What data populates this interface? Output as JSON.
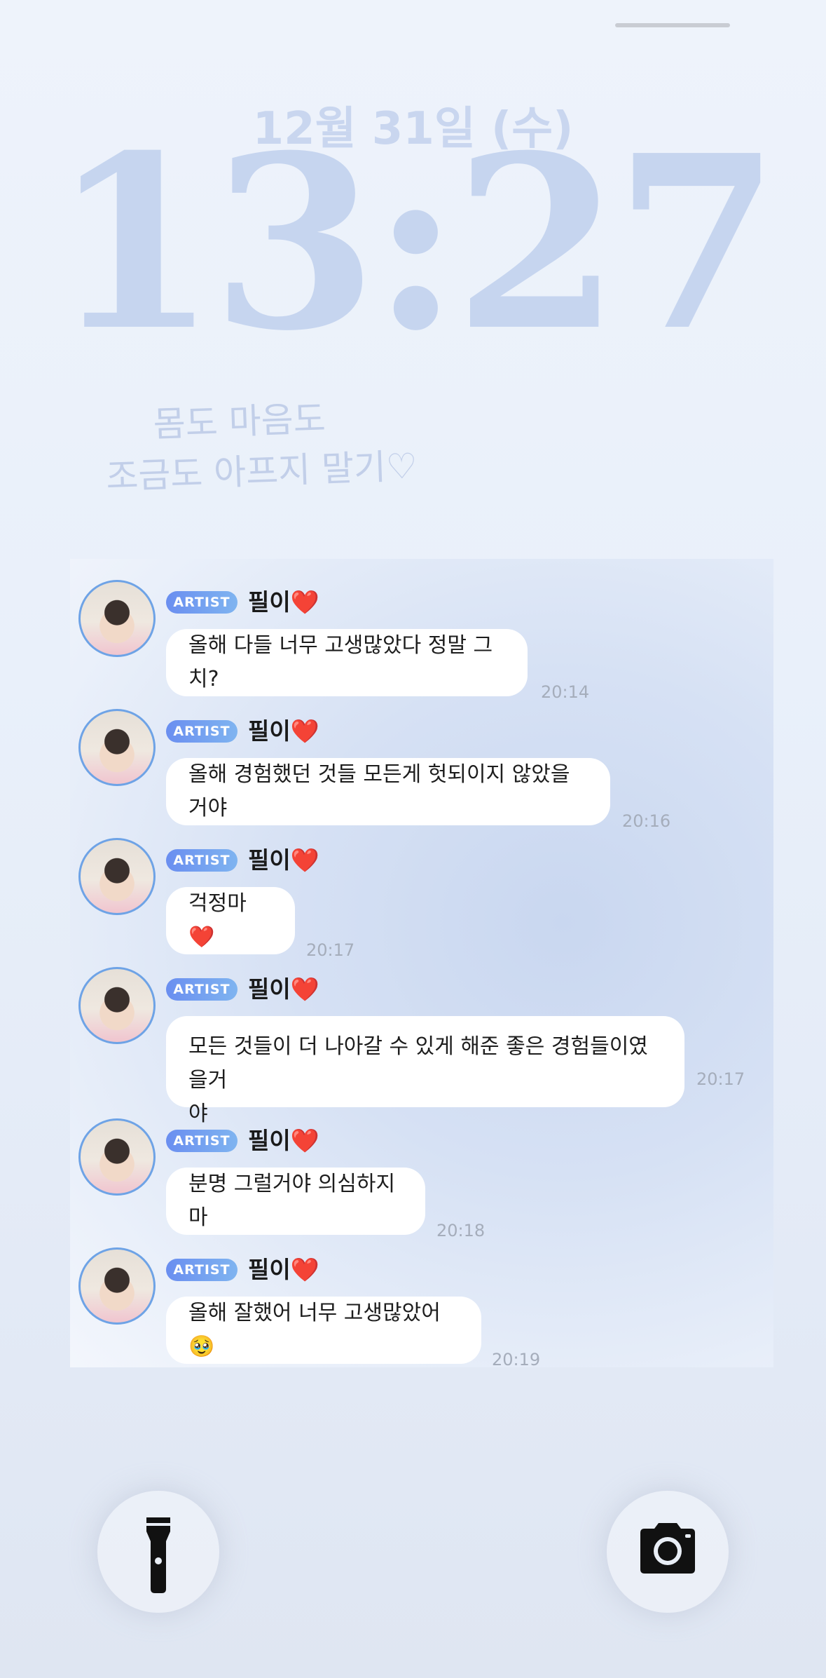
{
  "lockscreen": {
    "date": "12월 31일 (수)",
    "time": "13:27",
    "widget_line1": "몸도 마음도",
    "widget_line2": "조금도 아프지 말기♡"
  },
  "chat": {
    "messages": [
      {
        "badge": "ARTIST",
        "sender": "필이❤️",
        "text": "올해 다들 너무 고생많았다 정말 그치?",
        "time": "20:14"
      },
      {
        "badge": "ARTIST",
        "sender": "필이❤️",
        "text": "올해 경험했던 것들 모든게 헛되이지 않았을거야",
        "time": "20:16"
      },
      {
        "badge": "ARTIST",
        "sender": "필이❤️",
        "text": "걱정마❤️",
        "time": "20:17"
      },
      {
        "badge": "ARTIST",
        "sender": "필이❤️",
        "text_line1": "모든 것들이 더 나아갈 수 있게 해준 좋은 경험들이였을거",
        "text_line2": "야",
        "time": "20:17"
      },
      {
        "badge": "ARTIST",
        "sender": "필이❤️",
        "text": "분명 그럴거야 의심하지마",
        "time": "20:18"
      },
      {
        "badge": "ARTIST",
        "sender": "필이❤️",
        "text": "올해 잘했어 너무 고생많았어🥹",
        "time": "20:19"
      }
    ]
  },
  "controls": {
    "flashlight_icon": "flashlight-icon",
    "camera_icon": "camera-icon"
  }
}
